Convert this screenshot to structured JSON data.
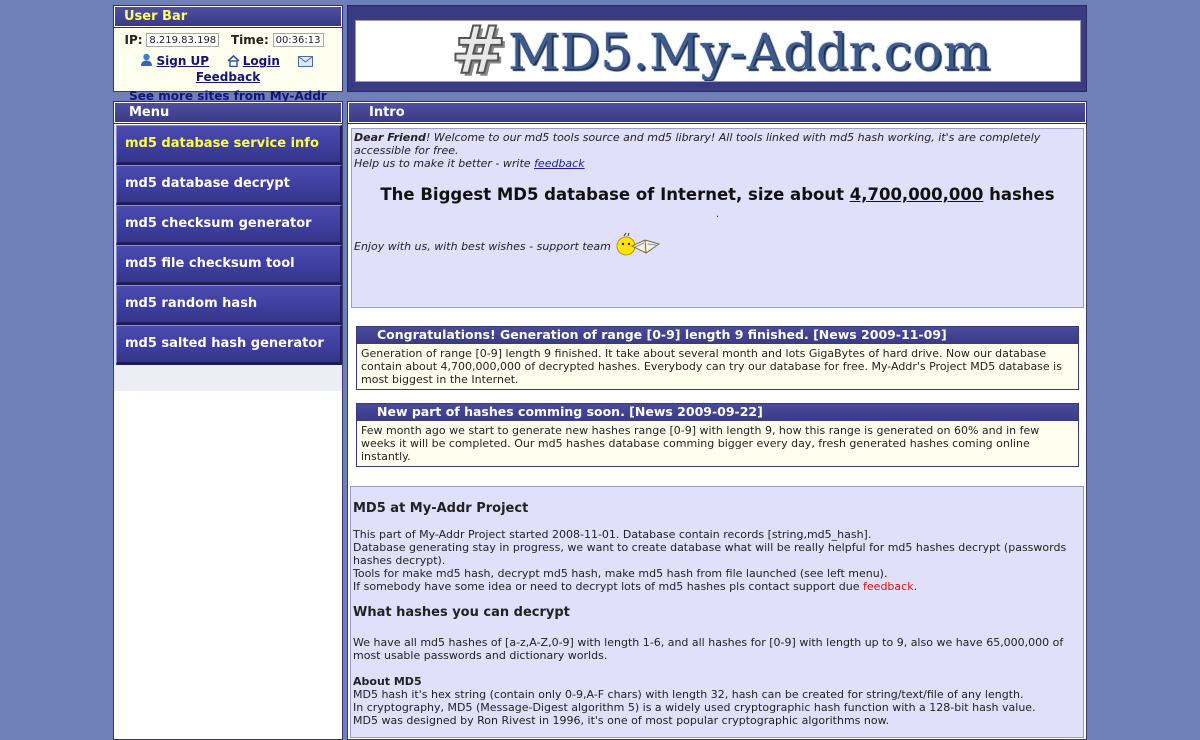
{
  "userbar": {
    "title": "User Bar",
    "ip_label": "IP:",
    "ip_value": "8.219.83.198",
    "time_label": "Time:",
    "time_value": "00:36:13",
    "signup": "Sign UP",
    "login": "Login",
    "feedback": "Feedback",
    "more_sites": "See more sites from My-Addr"
  },
  "header": {
    "logo_hash": "#",
    "logo_text": "MD5.My-Addr.com"
  },
  "menu": {
    "title": "Menu",
    "items": [
      "md5 database service info",
      "md5 database decrypt",
      "md5 checksum generator",
      "md5 file checksum tool",
      "md5 random hash",
      "md5 salted hash generator"
    ]
  },
  "intro": {
    "title": "Intro",
    "dear": "Dear Friend",
    "welcome": "! Welcome to our md5 tools source and md5 library! All tools linked with md5 hash working, it's are completely accessible for free.",
    "help": "Help us to make it better - write ",
    "feedback_link": "feedback",
    "big_pre": "The Biggest MD5 database of Internet, size about ",
    "big_num": "4,700,000,000",
    "big_post": " hashes",
    "dot": ".",
    "enjoy": "Enjoy with us, with best wishes - support team"
  },
  "news": [
    {
      "title": "Congratulations! Generation of range [0-9] length 9 finished. [News 2009-11-09]",
      "body": "Generation of range [0-9] length 9 finished. It take about several month and lots GigaBytes of hard drive. Now our database contain about 4,700,000,000 of decrypted hashes. Everybody can try our database for free. My-Addr's Project MD5 database is most biggest in the Internet."
    },
    {
      "title": "New part of hashes comming soon. [News 2009-09-22]",
      "body": "Few month ago we start to generate new hashes range [0-9] with length 9, how this range is generated on 60% and in few weeks it will be completed. Our md5 hashes database comming bigger every day, fresh generated hashes coming online instantly."
    }
  ],
  "info": {
    "h1": "MD5 at My-Addr Project",
    "p1": "This part of My-Addr Project started 2008-11-01. Database contain records [string,md5_hash].",
    "p2": "Database generating stay in progress, we want to create database what will be really helpful for md5 hashes decrypt (passwords hashes decrypt).",
    "p3": "Tools for make md5 hash, decrypt md5 hash, make md5 hash from file launched (see left menu).",
    "p4": "If somebody have some idea or need to decrypt lots of md5 hashes pls contact support due ",
    "p4_link": "feedback",
    "p4_end": ".",
    "h2": "What hashes you can decrypt",
    "p5": "We have all md5 hashes of [a-z,A-Z,0-9] with length 1-6, and all hashes for [0-9] with length up to 9, also we have 65,000,000 of most usable passwords and dictionary worlds.",
    "about_title": "About MD5",
    "a1": "MD5 hash it's hex string (contain only 0-9,A-F chars) with length 32, hash can be created for string/text/file of any length.",
    "a2": "In cryptography, MD5 (Message-Digest algorithm 5) is a widely used cryptographic hash function with a 128-bit hash value.",
    "a3": "MD5 was designed by Ron Rivest in 1996, it's one of most popular cryptographic algorithms now."
  },
  "colors": {
    "page_bg": "#6f7fb7",
    "bar": "#3a3a86",
    "menu_active": "#ffff44",
    "panel": "#e0e0fa",
    "link_red": "#dd1111"
  }
}
